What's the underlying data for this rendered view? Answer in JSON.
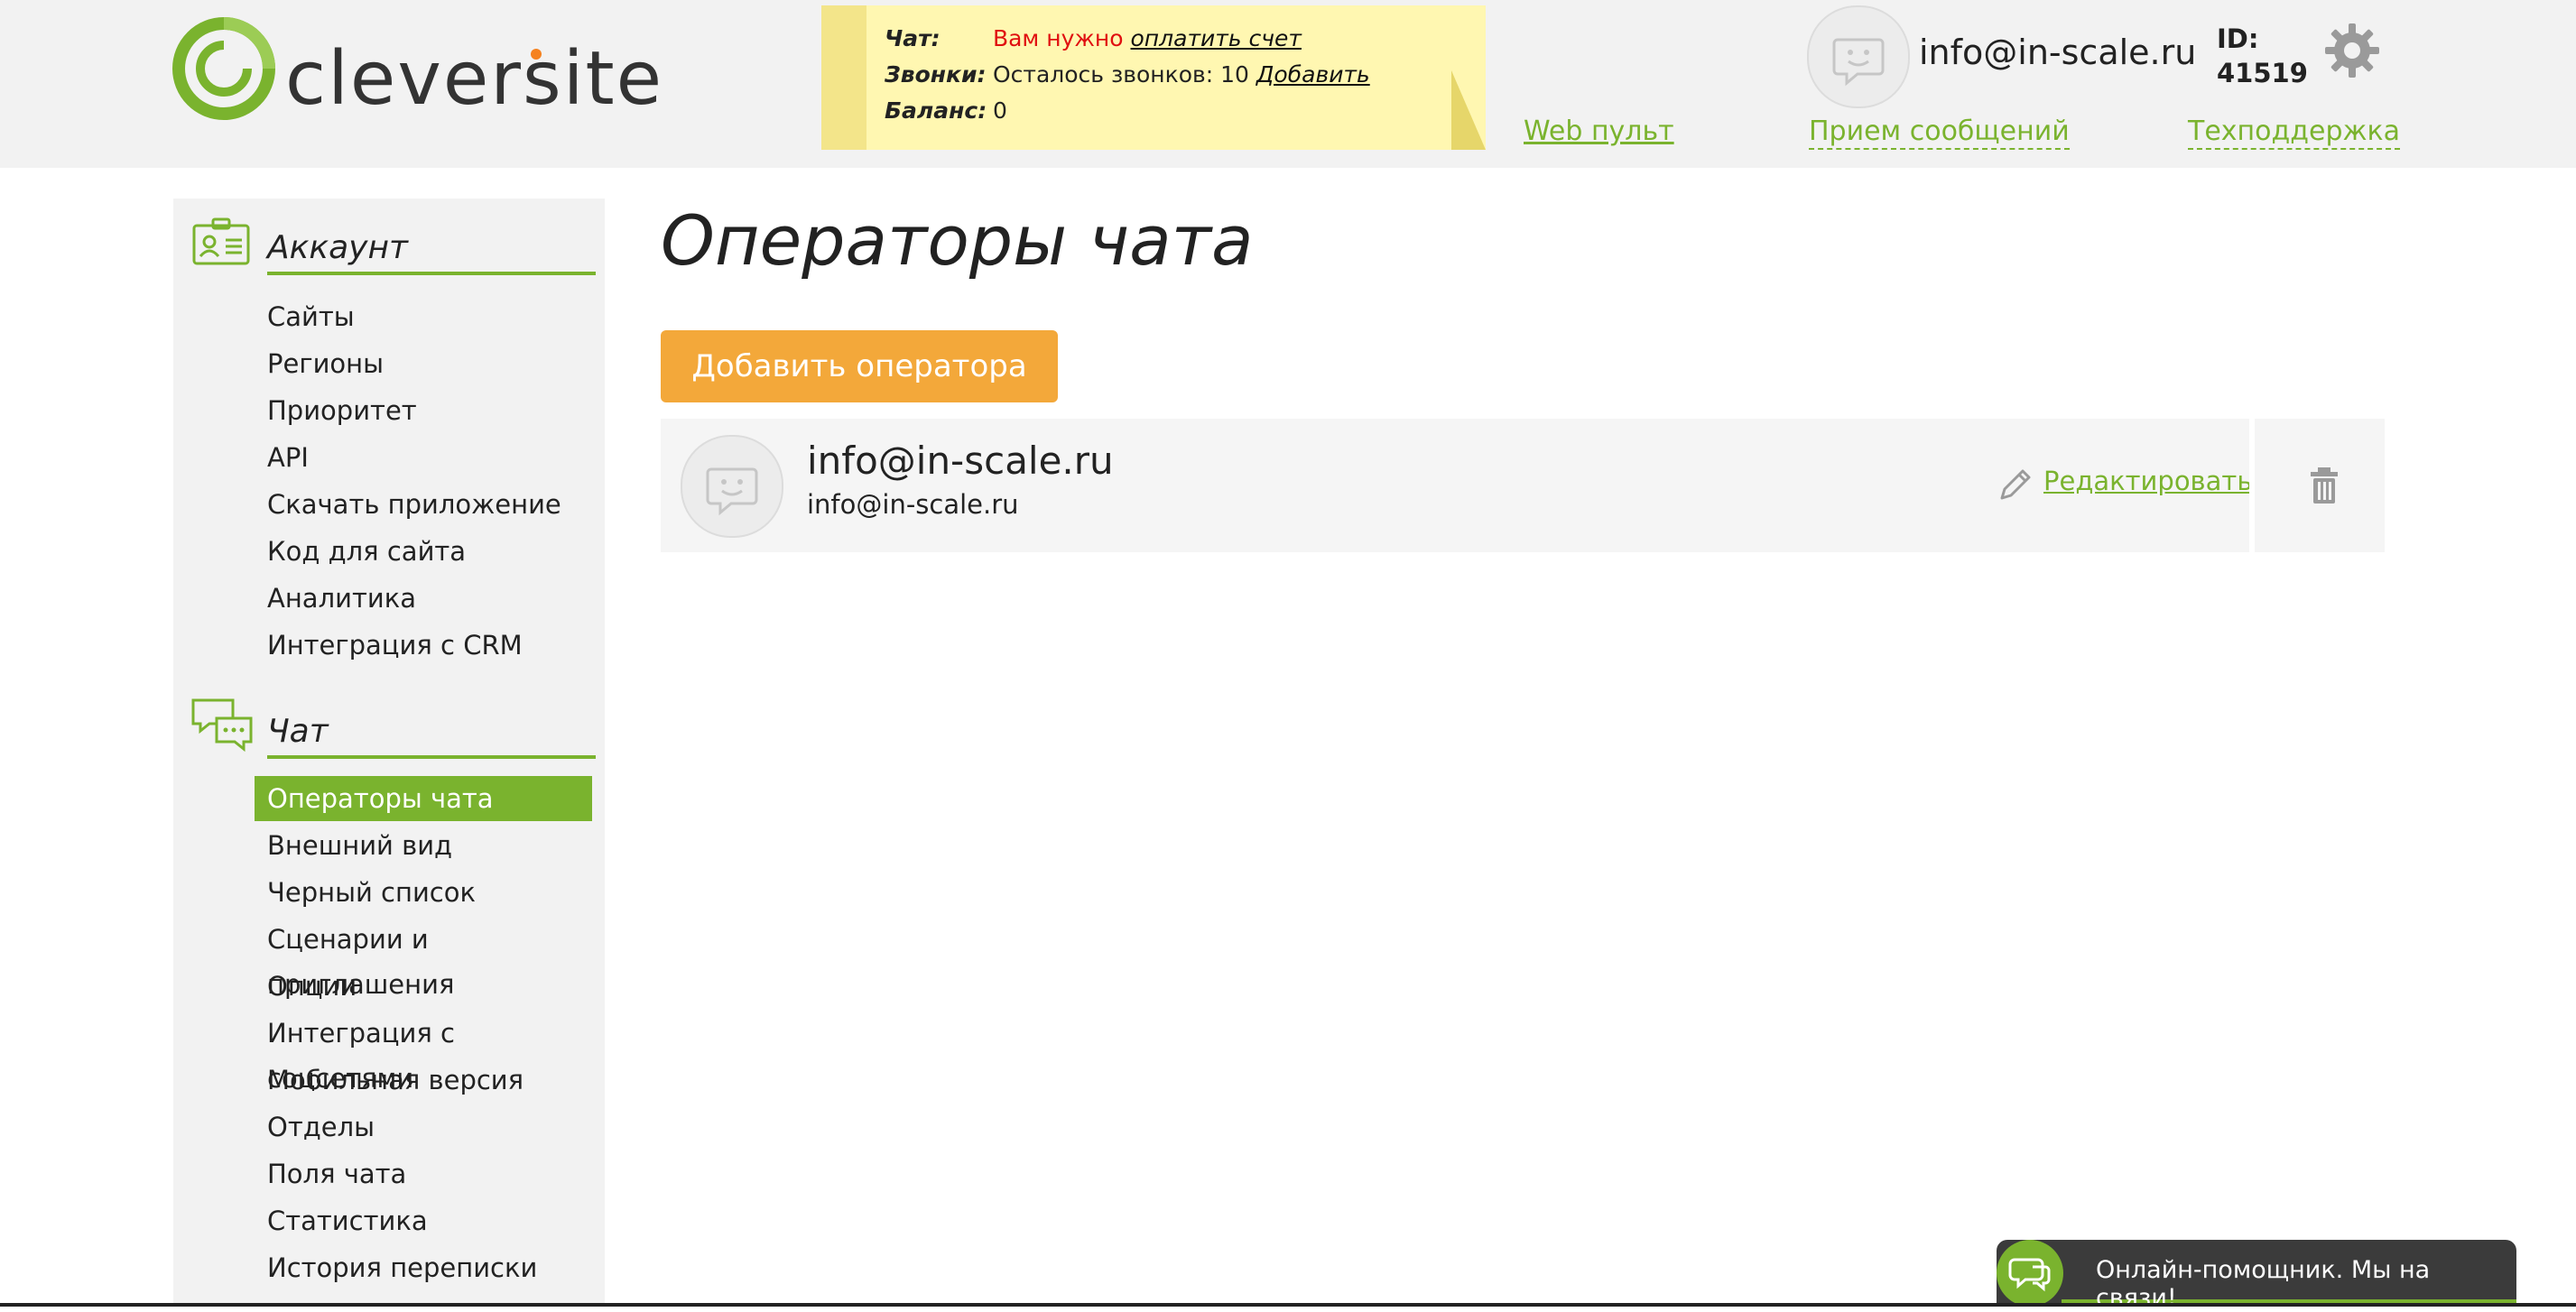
{
  "brand": {
    "logo_text": "cleversite",
    "accent": "#7ab32e",
    "orange": "#f58220"
  },
  "notice": {
    "chat_label": "Чат:",
    "chat_text": "Вам нужно",
    "chat_link": "оплатить счет",
    "calls_label": "Звонки:",
    "calls_text": "Осталось звонков: 10",
    "calls_link": "Добавить",
    "balance_label": "Баланс:",
    "balance_value": "0"
  },
  "header": {
    "email": "info@in-scale.ru",
    "id_label": "ID:",
    "id_value": "41519",
    "links": [
      "Web пульт",
      "Прием сообщений",
      "Техподдержка"
    ]
  },
  "sidebar": {
    "account": {
      "title": "Аккаунт",
      "items": [
        "Сайты",
        "Регионы",
        "Приоритет",
        "API",
        "Скачать приложение",
        "Код для сайта",
        "Аналитика",
        "Интеграция с CRM"
      ]
    },
    "chat": {
      "title": "Чат",
      "items": [
        "Операторы чата",
        "Внешний вид",
        "Черный список",
        "Сценарии и приглашения",
        "Опции",
        "Интеграция с соцсетями",
        "Мобильная версия",
        "Отделы",
        "Поля чата",
        "Статистика",
        "История переписки"
      ],
      "active": "Операторы чата"
    }
  },
  "main": {
    "title": "Операторы чата",
    "add_button": "Добавить оператора",
    "operators": [
      {
        "name": "info@in-scale.ru",
        "email": "info@in-scale.ru",
        "edit_label": "Редактировать"
      }
    ]
  },
  "chat_widget": {
    "text": "Онлайн-помощник. Мы на связи!"
  }
}
